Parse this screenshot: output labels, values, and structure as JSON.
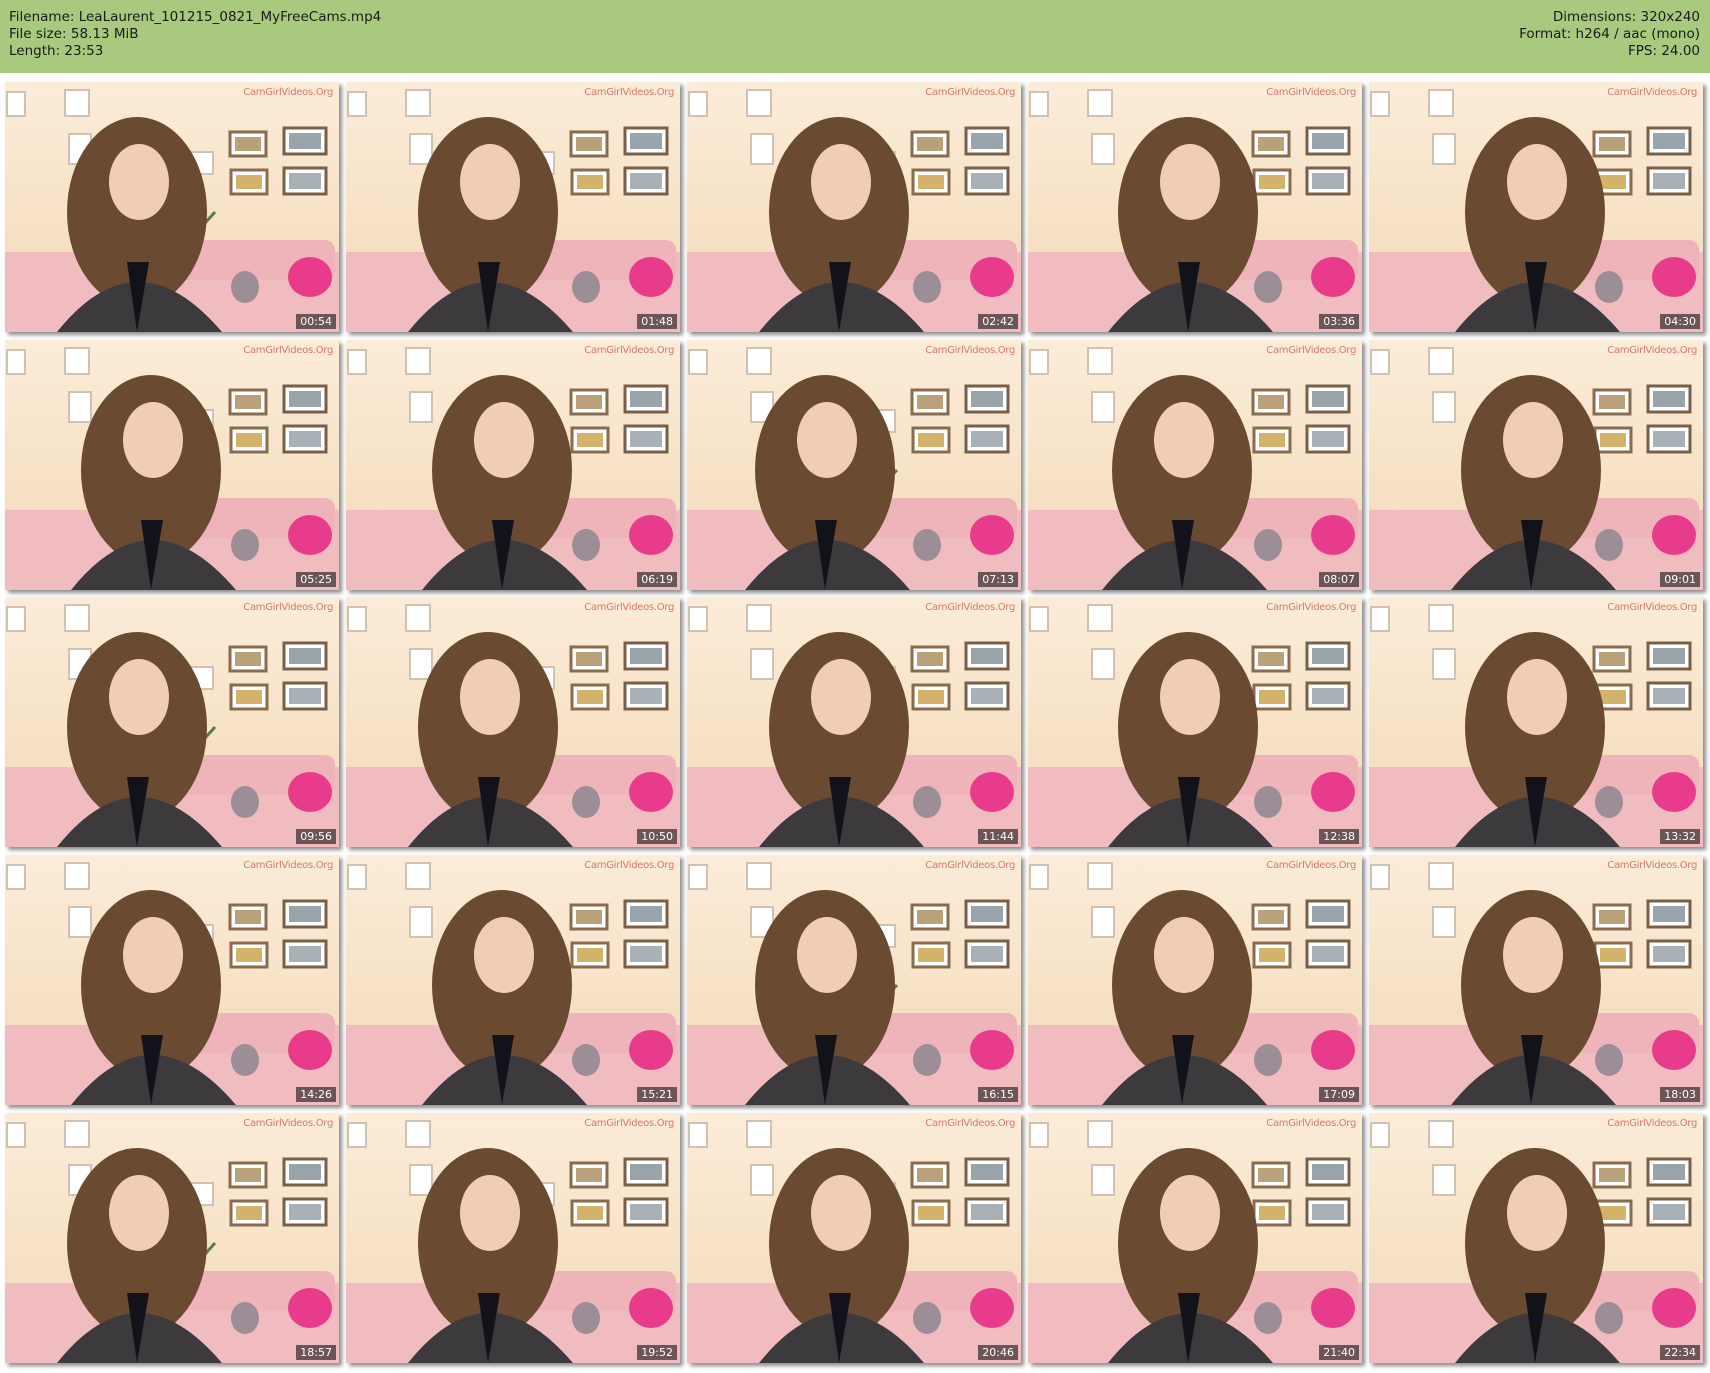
{
  "info": {
    "filename": "Filename: LeaLaurent_101215_0821_MyFreeCams.mp4",
    "filesize": "File size: 58.13 MiB",
    "length": "Length: 23:53",
    "dimensions": "Dimensions: 320x240",
    "format": "Format: h264 / aac (mono)",
    "fps": "FPS: 24.00"
  },
  "watermark": "CamGirlVideos.Org",
  "colors": {
    "header_bg": "#a9c97e",
    "timestamp_bg": "#000000"
  },
  "thumbnails": [
    {
      "time": "00:54"
    },
    {
      "time": "01:48"
    },
    {
      "time": "02:42"
    },
    {
      "time": "03:36"
    },
    {
      "time": "04:30"
    },
    {
      "time": "05:25"
    },
    {
      "time": "06:19"
    },
    {
      "time": "07:13"
    },
    {
      "time": "08:07"
    },
    {
      "time": "09:01"
    },
    {
      "time": "09:56"
    },
    {
      "time": "10:50"
    },
    {
      "time": "11:44"
    },
    {
      "time": "12:38"
    },
    {
      "time": "13:32"
    },
    {
      "time": "14:26"
    },
    {
      "time": "15:21"
    },
    {
      "time": "16:15"
    },
    {
      "time": "17:09"
    },
    {
      "time": "18:03"
    },
    {
      "time": "18:57"
    },
    {
      "time": "19:52"
    },
    {
      "time": "20:46"
    },
    {
      "time": "21:40"
    },
    {
      "time": "22:34"
    }
  ]
}
